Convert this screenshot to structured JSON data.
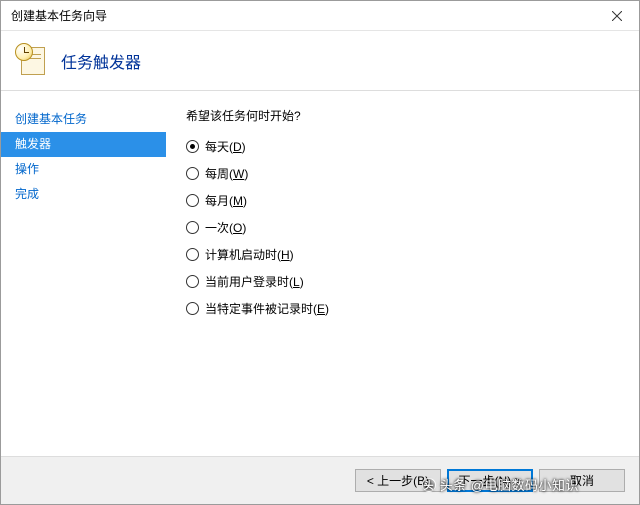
{
  "window": {
    "title": "创建基本任务向导"
  },
  "header": {
    "title": "任务触发器"
  },
  "sidebar": {
    "items": [
      {
        "label": "创建基本任务",
        "selected": false
      },
      {
        "label": "触发器",
        "selected": true
      },
      {
        "label": "操作",
        "selected": false
      },
      {
        "label": "完成",
        "selected": false
      }
    ]
  },
  "content": {
    "question": "希望该任务何时开始?",
    "options": [
      {
        "text": "每天",
        "mnemonic": "D",
        "checked": true
      },
      {
        "text": "每周",
        "mnemonic": "W",
        "checked": false
      },
      {
        "text": "每月",
        "mnemonic": "M",
        "checked": false
      },
      {
        "text": "一次",
        "mnemonic": "O",
        "checked": false
      },
      {
        "text": "计算机启动时",
        "mnemonic": "H",
        "checked": false
      },
      {
        "text": "当前用户登录时",
        "mnemonic": "L",
        "checked": false
      },
      {
        "text": "当特定事件被记录时",
        "mnemonic": "E",
        "checked": false
      }
    ]
  },
  "footer": {
    "back": "< 上一步(B)",
    "next": "下一步(N) >",
    "cancel": "取消"
  },
  "watermark": "头条 @电脑数码小知识"
}
